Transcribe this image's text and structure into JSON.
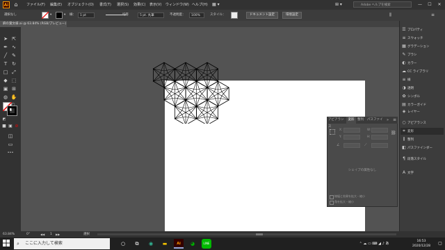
{
  "menubar": {
    "logo": "Ai",
    "items": [
      "ファイル(F)",
      "編集(E)",
      "オブジェクト(O)",
      "書式(T)",
      "選択(S)",
      "効果(C)",
      "表示(V)",
      "ウィンドウ(W)",
      "ヘルプ(H)"
    ],
    "search_placeholder": "Adobe ヘルプを検索"
  },
  "control_bar": {
    "selection_label": "選択なし",
    "stroke_label": "線：",
    "stroke_value": "1 pt",
    "line_style": "均等",
    "brush_value": "5 pt. 丸筆",
    "opacity_label": "不透明度：",
    "opacity_value": "100%",
    "style_label": "スタイル：",
    "doc_setup_button": "ドキュメント設定",
    "prefs_button": "環境設定"
  },
  "document_tab": {
    "label": "麻の葉文様.ai @ 63.84% (RGB/プレビュー)",
    "close": "×"
  },
  "right_panels": [
    {
      "icon": "properties-icon",
      "glyph": "☰",
      "label": "プロパティ"
    },
    {
      "icon": "layers-icon",
      "glyph": "≡",
      "label": "スウォッチ"
    },
    {
      "icon": "gradient-icon",
      "glyph": "▦",
      "label": "グラデーション"
    },
    {
      "icon": "brush-icon",
      "glyph": "✎",
      "label": "ブラシ"
    },
    {
      "icon": "color-icon",
      "glyph": "◐",
      "label": "カラー"
    },
    {
      "icon": "cc-library-icon",
      "glyph": "☁",
      "label": "CC ライブラリ"
    },
    {
      "icon": "stroke-icon",
      "glyph": "≡",
      "label": "線"
    },
    {
      "icon": "transparency-icon",
      "glyph": "◑",
      "label": "透明"
    },
    {
      "icon": "symbol-icon",
      "glyph": "✿",
      "label": "シンボル"
    },
    {
      "icon": "color-guide-icon",
      "glyph": "▤",
      "label": "カラーガイド"
    },
    {
      "icon": "layers-icon",
      "glyph": "◈",
      "label": "レイヤー"
    },
    {
      "icon": "appearance-icon",
      "glyph": "○",
      "label": "アピアランス"
    },
    {
      "icon": "transform-icon",
      "glyph": "⌗",
      "label": "変形"
    },
    {
      "icon": "align-icon",
      "glyph": "⫼",
      "label": "整列"
    },
    {
      "icon": "pathfinder-icon",
      "glyph": "◧",
      "label": "パスファインダー"
    },
    {
      "icon": "paragraph-style-icon",
      "glyph": "¶",
      "label": "段落スタイル"
    },
    {
      "icon": "type-icon",
      "glyph": "A",
      "label": "文字"
    }
  ],
  "float_panel": {
    "tabs": [
      "アピアランス",
      "変形",
      "整列",
      "パスファイ"
    ],
    "active_tab": "変形",
    "empty_message": "シェイプの属性なし",
    "checkbox1": "線幅と効果を拡大・縮小",
    "checkbox2": "角を拡大・縮小",
    "field_x": "X:",
    "field_y": "Y:",
    "field_w": "W:",
    "field_h": "H:"
  },
  "statusbar": {
    "zoom": "63.84%",
    "angle": "0°",
    "page": "1",
    "tool": "選択"
  },
  "taskbar": {
    "search_placeholder": "ここに入力して検索",
    "time": "16:53",
    "date": "2020/12/28"
  },
  "colors": {
    "accent_orange": "#ff9a00",
    "app_bg": "#535353",
    "panel_bg": "#3c3c3c",
    "line_green": "#00b900"
  }
}
